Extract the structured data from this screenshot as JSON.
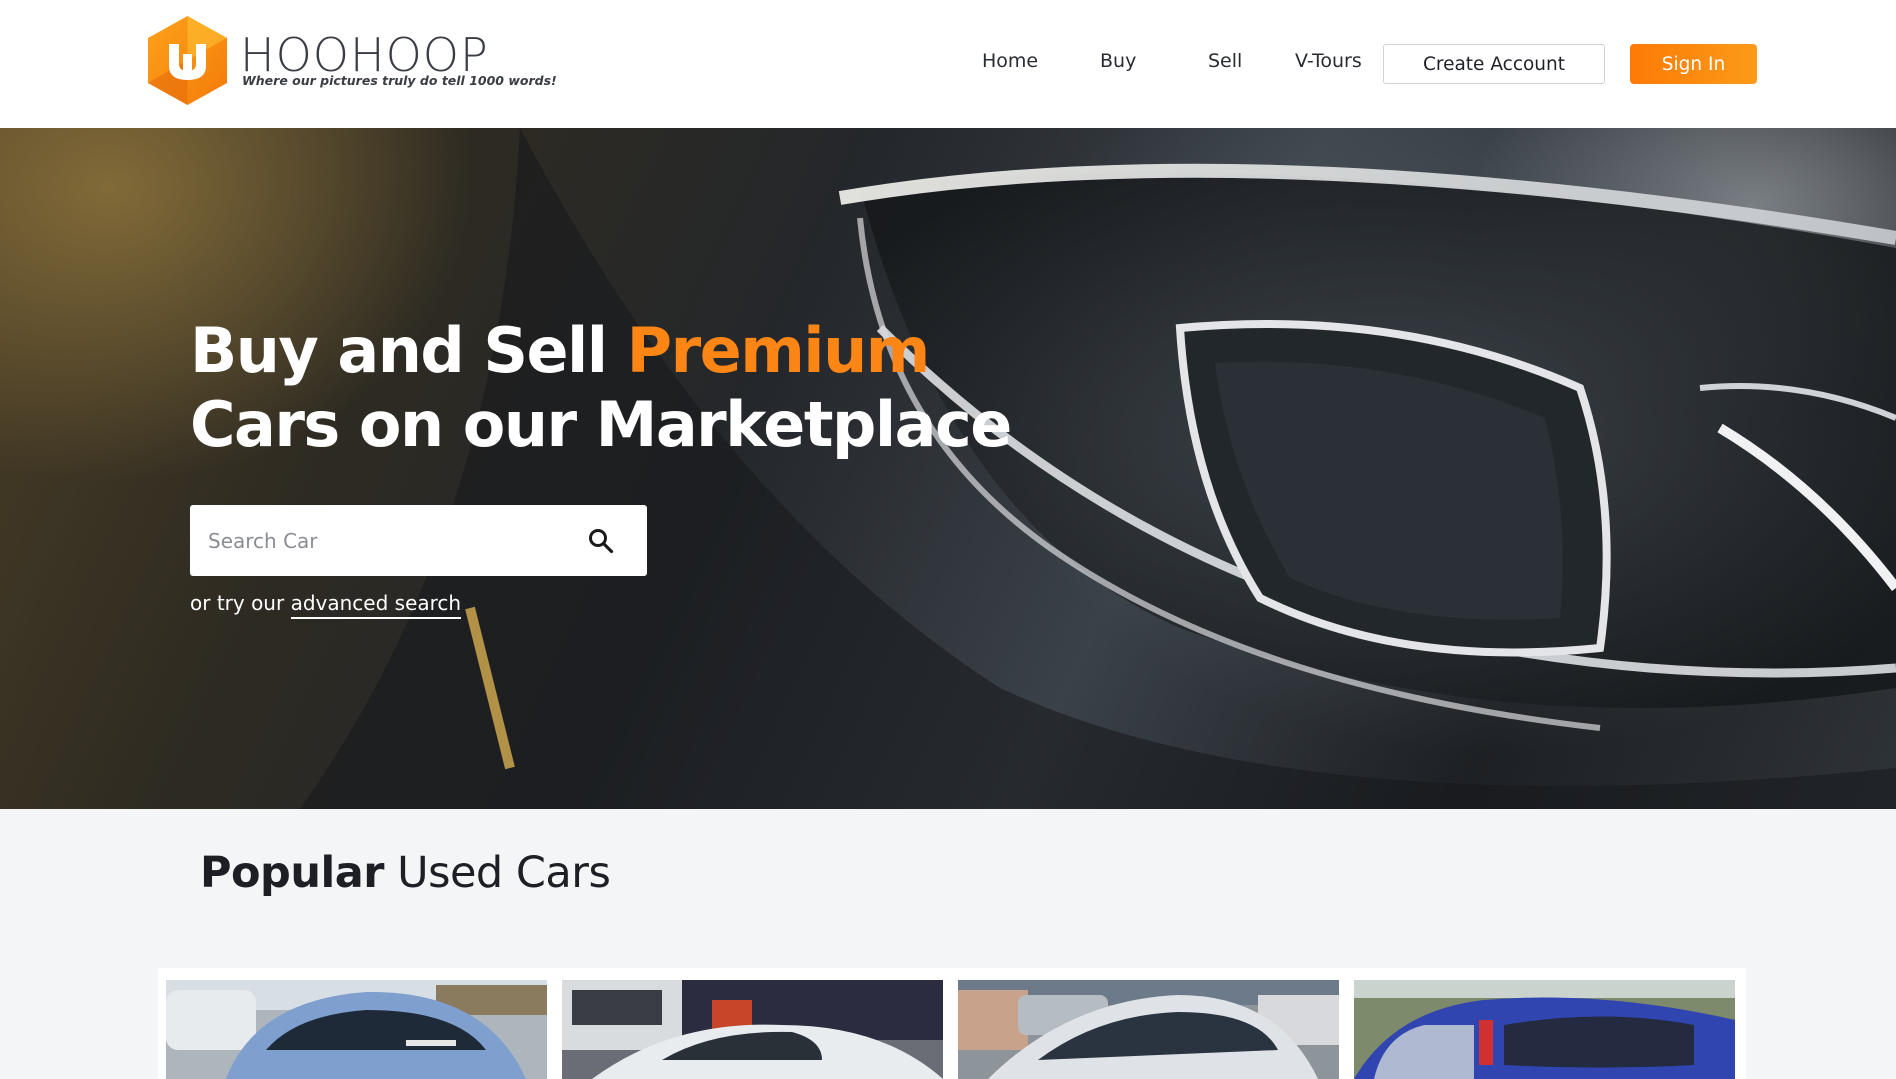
{
  "brand": {
    "name": "HOOHOOP",
    "tagline": "Where our pictures truly do tell 1000 words!",
    "colors": {
      "orange": "#fb8515",
      "dark": "#3a3d45"
    }
  },
  "nav": {
    "links": [
      "Home",
      "Buy",
      "Sell",
      "V-Tours"
    ],
    "create_account": "Create Account",
    "sign_in": "Sign In"
  },
  "hero": {
    "title_part1": "Buy and Sell ",
    "title_accent": "Premium",
    "title_part2": "Cars on our Marketplace",
    "search_placeholder": "Search Car",
    "advanced_prefix": "or try our ",
    "advanced_link": "advanced search"
  },
  "popular": {
    "title_bold": "Popular",
    "title_rest": " Used Cars",
    "cards": [
      {
        "image": "silver-hatchback-photo"
      },
      {
        "image": "white-hatchback-photo"
      },
      {
        "image": "silver-sedan-photo"
      },
      {
        "image": "blue-hatchback-photo"
      }
    ]
  }
}
